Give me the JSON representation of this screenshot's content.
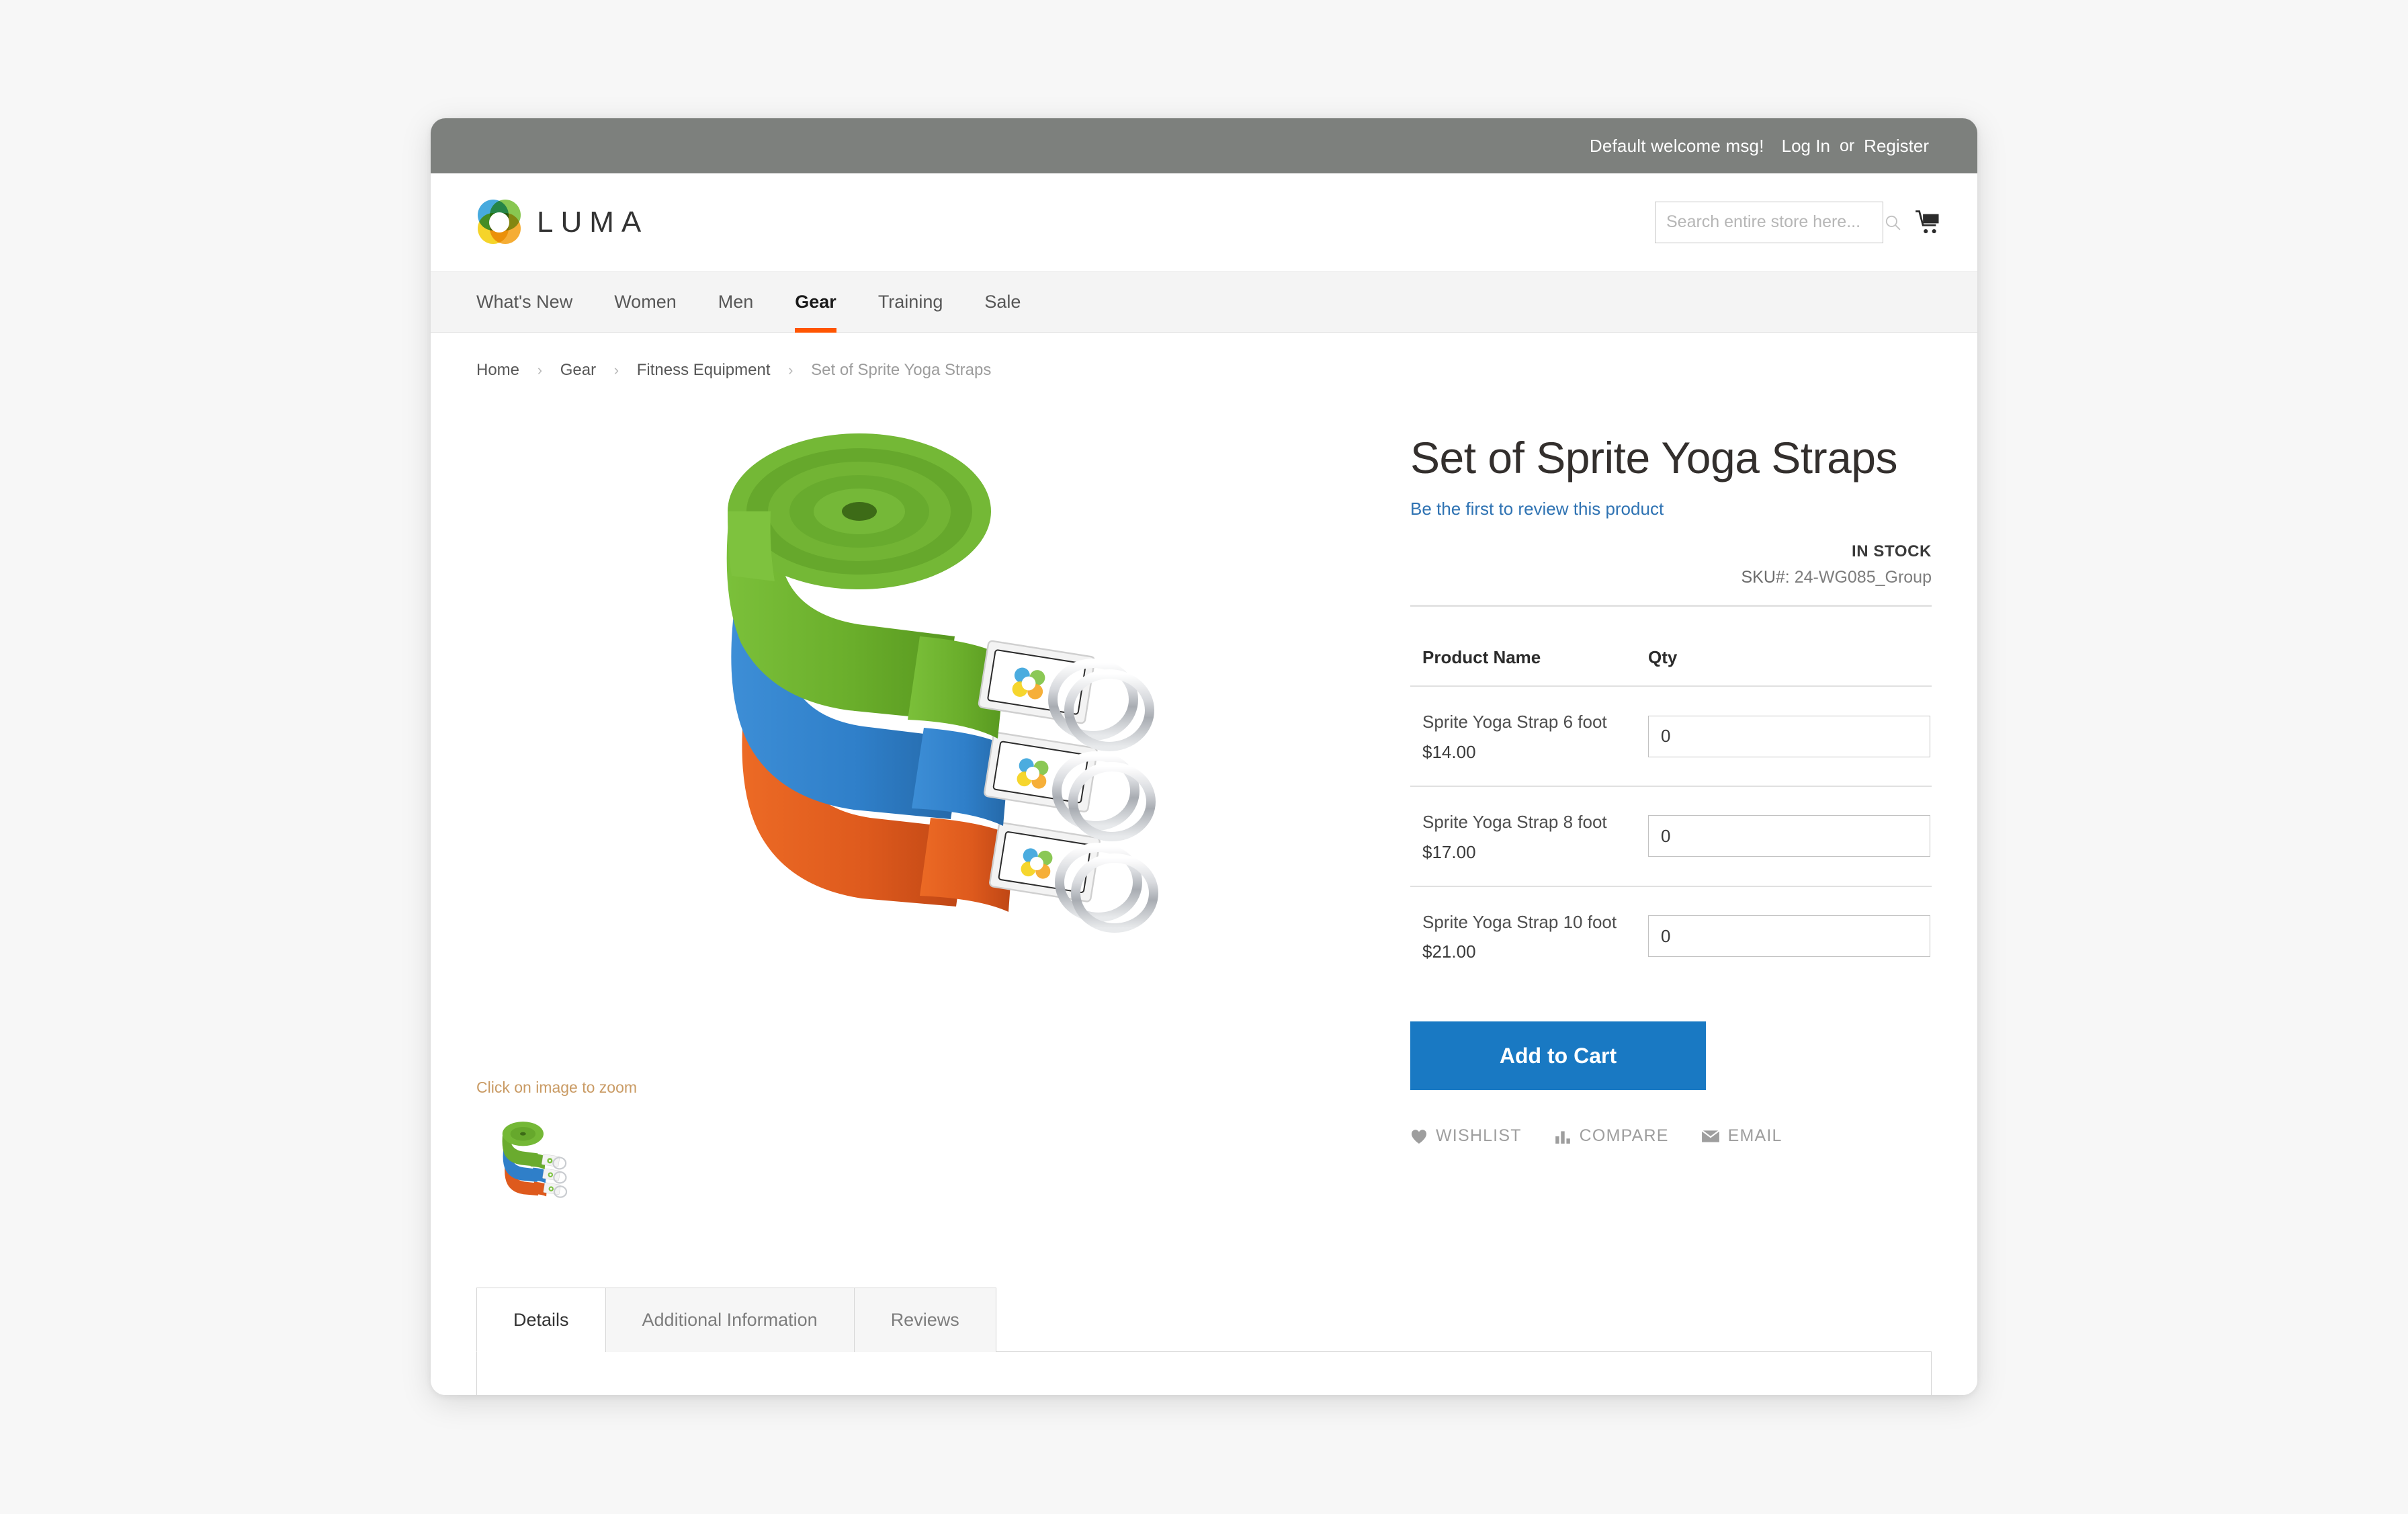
{
  "topbar": {
    "welcome": "Default welcome msg!",
    "login_label": "Log In",
    "or_label": "or",
    "register_label": "Register"
  },
  "header": {
    "logo_text": "LUMA",
    "search_placeholder": "Search entire store here...",
    "search_value": "",
    "cart_icon": "cart-icon",
    "search_icon": "search-icon"
  },
  "nav": {
    "items": [
      {
        "label": "What's New",
        "active": false
      },
      {
        "label": "Women",
        "active": false
      },
      {
        "label": "Men",
        "active": false
      },
      {
        "label": "Gear",
        "active": true
      },
      {
        "label": "Training",
        "active": false
      },
      {
        "label": "Sale",
        "active": false
      }
    ],
    "active_underline_color": "#ff5501"
  },
  "breadcrumb": {
    "items": [
      "Home",
      "Gear",
      "Fitness Equipment",
      "Set of Sprite Yoga Straps"
    ],
    "separator": "›"
  },
  "gallery": {
    "zoom_hint": "Click on image to zoom",
    "main_image_alt": "Set of Sprite Yoga Straps",
    "thumbnail_alt": "Set of Sprite Yoga Straps thumbnail",
    "strap_colors": [
      "#6aab2e",
      "#2f7fc9",
      "#de5a1d"
    ]
  },
  "product": {
    "title": "Set of Sprite Yoga Straps",
    "review_link": "Be the first to review this product",
    "stock_status": "IN STOCK",
    "sku_label": "SKU#:",
    "sku_value": "24-WG085_Group",
    "table": {
      "headers": [
        "Product Name",
        "Qty"
      ],
      "rows": [
        {
          "name": "Sprite Yoga Strap 6 foot",
          "price": "$14.00",
          "qty": "0"
        },
        {
          "name": "Sprite Yoga Strap 8 foot",
          "price": "$17.00",
          "qty": "0"
        },
        {
          "name": "Sprite Yoga Strap 10 foot",
          "price": "$21.00",
          "qty": "0"
        }
      ]
    },
    "add_to_cart_label": "Add to Cart",
    "actions": [
      {
        "label": "WISHLIST",
        "icon": "heart-icon"
      },
      {
        "label": "COMPARE",
        "icon": "bar-chart-icon"
      },
      {
        "label": "EMAIL",
        "icon": "envelope-icon"
      }
    ],
    "accent_button_color": "#1979c3",
    "link_color": "#2f73b3"
  },
  "tabs": {
    "items": [
      {
        "label": "Details",
        "active": true
      },
      {
        "label": "Additional Information",
        "active": false
      },
      {
        "label": "Reviews",
        "active": false
      }
    ]
  }
}
